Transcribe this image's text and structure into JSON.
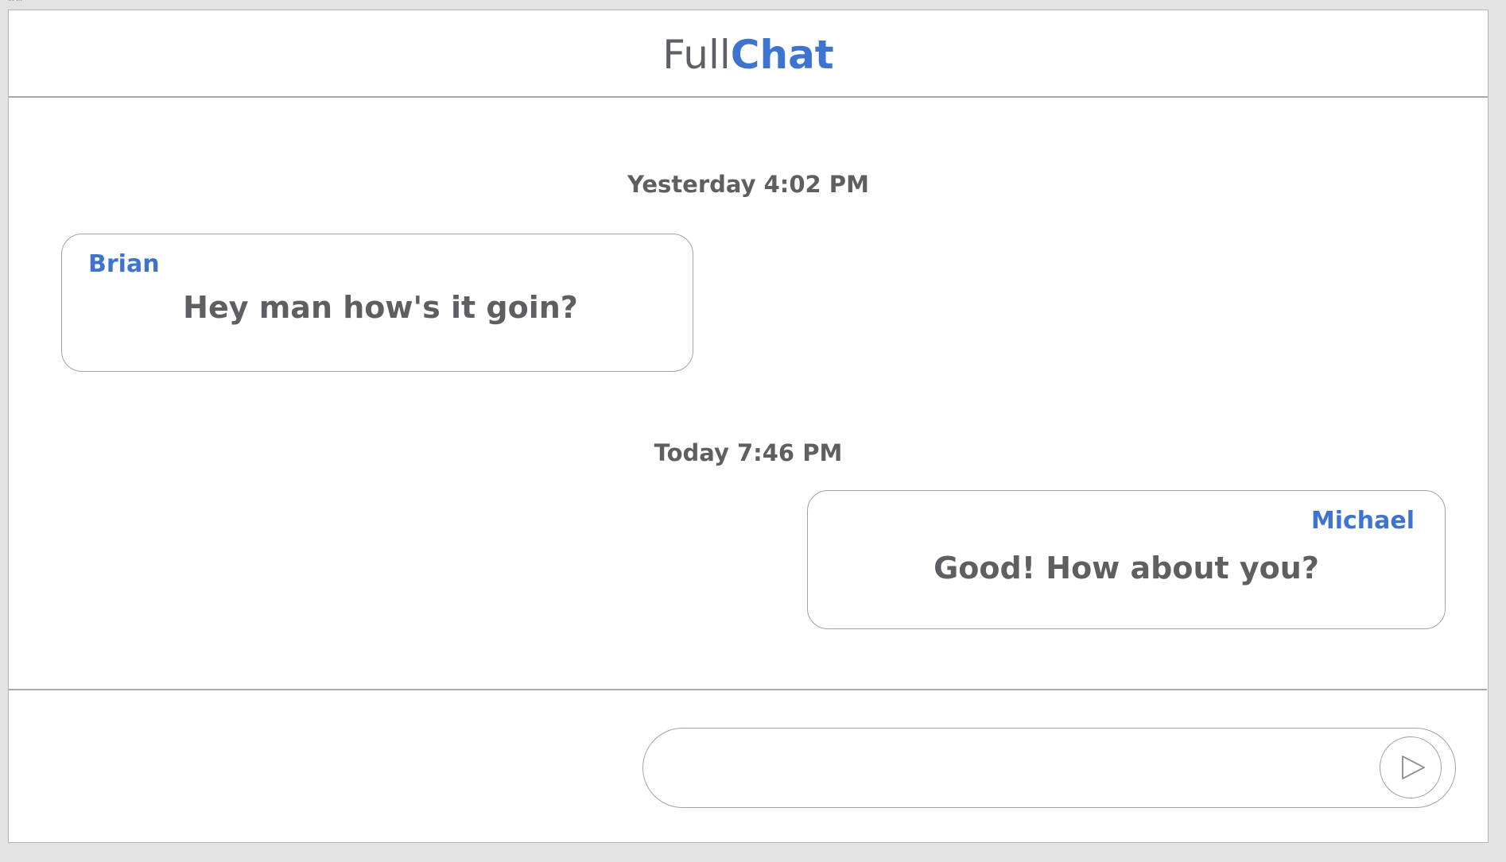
{
  "window": {
    "tab_title": "... ..."
  },
  "header": {
    "brand_part1": "Full",
    "brand_part2": "Chat"
  },
  "conversation": {
    "groups": [
      {
        "timestamp": "Yesterday 4:02 PM",
        "message": {
          "sender": "Brian",
          "text": "Hey man how's it goin?",
          "side": "left"
        }
      },
      {
        "timestamp": "Today 7:46 PM",
        "message": {
          "sender": "Michael",
          "text": "Good! How about you?",
          "side": "right"
        }
      }
    ]
  },
  "composer": {
    "value": "",
    "placeholder": "",
    "send_icon": "send-icon"
  },
  "colors": {
    "accent": "#3d74cf",
    "text": "#5e5f63",
    "border": "#a3a3a3"
  }
}
